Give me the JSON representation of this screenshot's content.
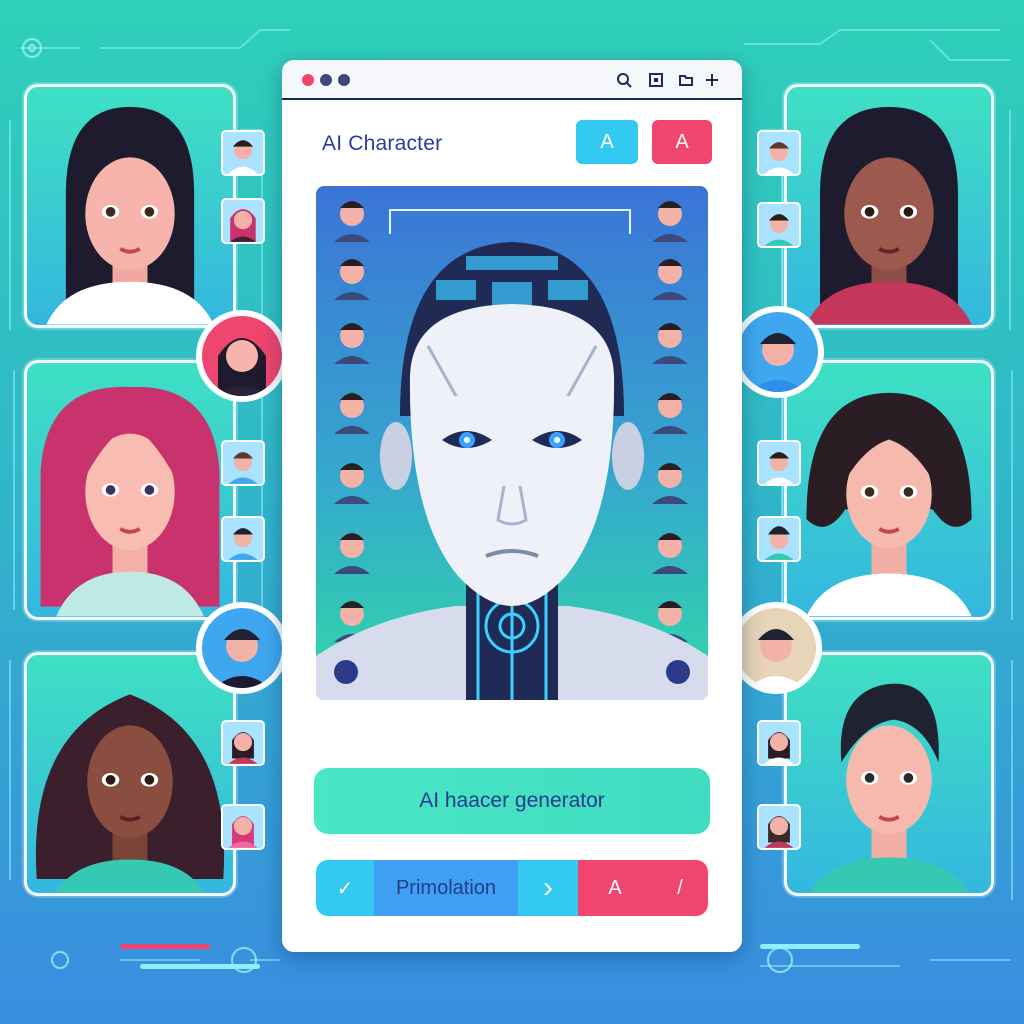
{
  "window": {
    "app_title": "AI Character",
    "tool_button_a": "A",
    "tool_button_b": "A",
    "generate_label": "AI haacer generator",
    "action_check": "✓",
    "action_label": "Primolation",
    "action_next": "›",
    "action_text_tool": "A",
    "action_pen": "/"
  },
  "titlebar_icons": [
    "search-icon",
    "image-icon",
    "folder-icon",
    "plus-icon"
  ],
  "colors": {
    "accent_cyan": "#34c9f0",
    "accent_pink": "#f0456f",
    "accent_teal": "#45e2c4",
    "title_blue": "#2d3aa0"
  }
}
